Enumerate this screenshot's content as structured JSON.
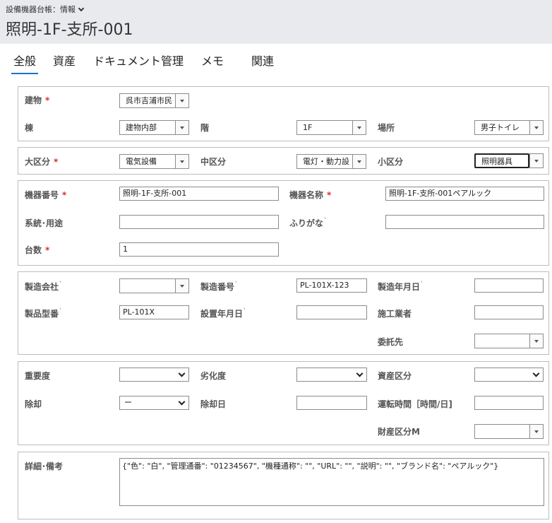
{
  "header": {
    "breadcrumb": "設備機器台帳：情報",
    "title": "照明-1F-支所-001"
  },
  "tabs": [
    "全般",
    "資産",
    "ドキュメント管理",
    "メモ",
    "関連"
  ],
  "location": {
    "building_label": "建物",
    "building_value": "呉市吉浦市民",
    "wing_label": "棟",
    "wing_value": "建物内部",
    "floor_label": "階",
    "floor_value": "1F",
    "place_label": "場所",
    "place_value": "男子トイレ"
  },
  "category": {
    "major_label": "大区分",
    "major_value": "電気設備",
    "middle_label": "中区分",
    "middle_value": "電灯・動力設",
    "minor_label": "小区分",
    "minor_value": "照明器具"
  },
  "equipment": {
    "number_label": "機器番号",
    "number_value": "照明-1F-支所-001",
    "name_label": "機器名称",
    "name_value": "照明-1F-支所-001ペアルック",
    "system_label": "系統･用途",
    "system_value": "",
    "furigana_label": "ふりがな",
    "furigana_value": "",
    "count_label": "台数",
    "count_value": "1"
  },
  "manufacture": {
    "maker_label": "製造会社",
    "maker_value": "",
    "serial_label": "製造番号",
    "serial_value": "PL-101X-123",
    "date_label": "製造年月日",
    "date_value": "",
    "model_label": "製品型番",
    "model_value": "PL-101X",
    "install_label": "設置年月日",
    "install_value": "",
    "contractor_label": "施工業者",
    "contractor_value": "",
    "consign_label": "委託先",
    "consign_value": ""
  },
  "status": {
    "importance_label": "重要度",
    "importance_value": "",
    "degradation_label": "劣化度",
    "degradation_value": "",
    "asset_class_label": "資産区分",
    "asset_class_value": "",
    "disposal_label": "除却",
    "disposal_value": "ー",
    "disposal_date_label": "除却日",
    "disposal_date_value": "",
    "operating_label": "運転時間［時間/日]",
    "operating_value": "",
    "property_label": "財産区分M",
    "property_value": ""
  },
  "details": {
    "label": "詳細･備考",
    "value": "{\"色\": \"白\", \"管理通番\": \"01234567\", \"機種通称\": \"\", \"URL\": \"\", \"説明\": \"\", \"ブランド名\": \"ペアルック\"}"
  },
  "required_mark": "*",
  "colors": {
    "header_bg": "#e8eaed",
    "accent": "#1a73c8",
    "required": "#d32f2f"
  }
}
